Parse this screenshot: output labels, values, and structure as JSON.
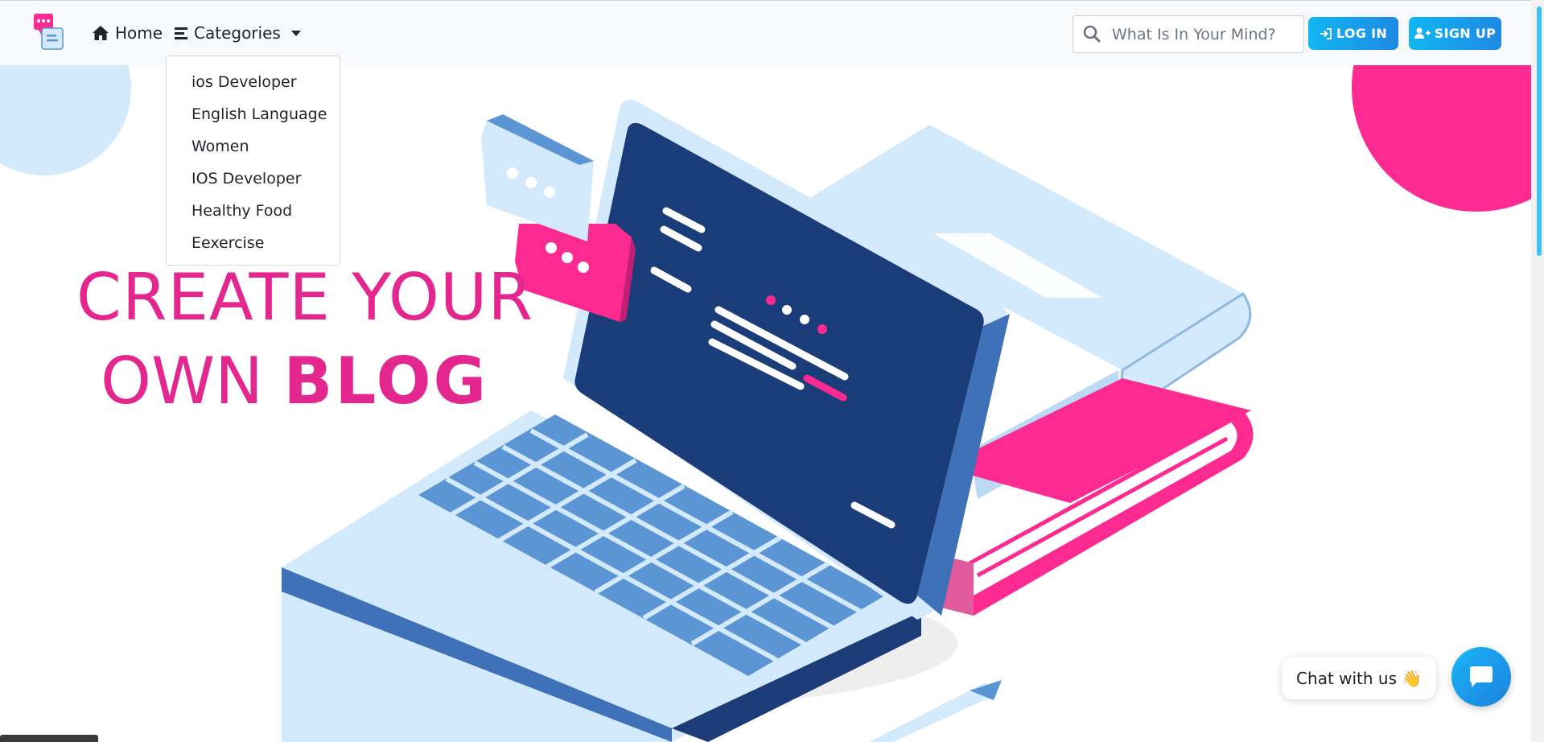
{
  "nav": {
    "home_label": "Home",
    "categories_label": "Categories",
    "search_placeholder": "What Is In Your Mind?",
    "login_label": "LOG IN",
    "signup_label": "SIGN UP"
  },
  "categories": [
    {
      "label": "ios Developer"
    },
    {
      "label": "English Language"
    },
    {
      "label": "Women"
    },
    {
      "label": "IOS Developer"
    },
    {
      "label": "Healthy Food"
    },
    {
      "label": "Eexercise"
    }
  ],
  "hero": {
    "line1": "CREATE YOUR",
    "line2_prefix": "OWN ",
    "line2_bold": "BLOG"
  },
  "chat": {
    "label": "Chat with us",
    "emoji": "👋"
  },
  "colors": {
    "accent_pink": "#e3278e",
    "accent_blue": "#11b7f2",
    "navbar_bg": "#f8f9fa"
  }
}
